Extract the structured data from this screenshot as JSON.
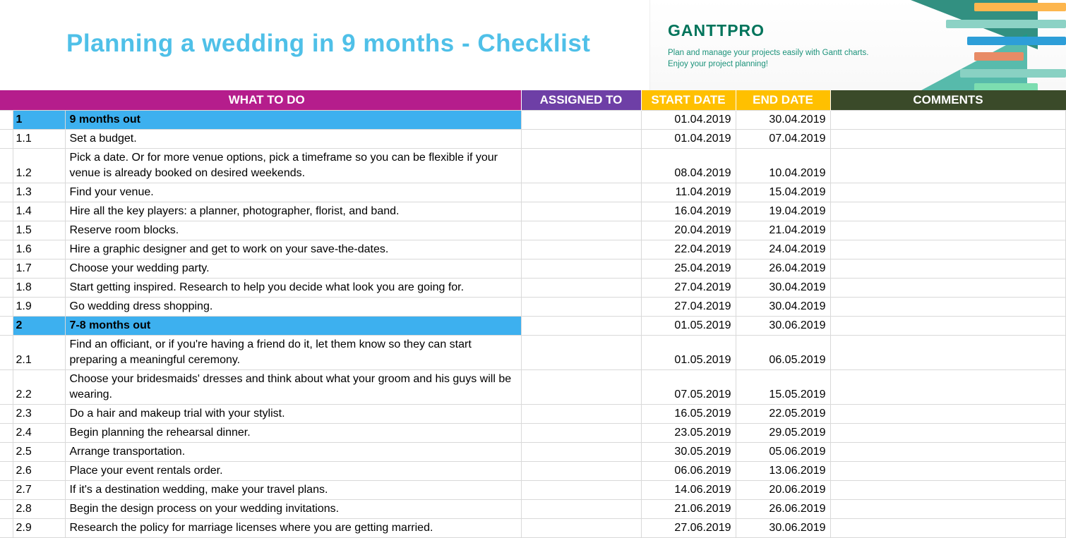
{
  "title": "Planning a wedding in 9 months - Checklist",
  "promo": {
    "logo": "GANTTPRO",
    "line1": "Plan and manage your projects easily with Gantt charts.",
    "line2": "Enjoy your project planning!"
  },
  "headers": {
    "what": "WHAT TO DO",
    "assigned": "ASSIGNED TO",
    "start": "START DATE",
    "end": "END DATE",
    "comments": "COMMENTS"
  },
  "rows": [
    {
      "idx": "1",
      "what": "9 months out",
      "start": "01.04.2019",
      "end": "30.04.2019",
      "section": true
    },
    {
      "idx": "1.1",
      "what": "Set a budget.",
      "start": "01.04.2019",
      "end": "07.04.2019"
    },
    {
      "idx": "1.2",
      "what": "Pick a date. Or for more venue options, pick a timeframe so you can be flexible if your venue is already booked on desired weekends.",
      "start": "08.04.2019",
      "end": "10.04.2019",
      "tall": true
    },
    {
      "idx": "1.3",
      "what": "Find your venue.",
      "start": "11.04.2019",
      "end": "15.04.2019"
    },
    {
      "idx": "1.4",
      "what": "Hire all the key players: a planner, photographer, florist, and band.",
      "start": "16.04.2019",
      "end": "19.04.2019"
    },
    {
      "idx": "1.5",
      "what": "Reserve room blocks.",
      "start": "20.04.2019",
      "end": "21.04.2019"
    },
    {
      "idx": "1.6",
      "what": "Hire a graphic designer and get to work on your save-the-dates.",
      "start": "22.04.2019",
      "end": "24.04.2019"
    },
    {
      "idx": "1.7",
      "what": "Choose your wedding party.",
      "start": "25.04.2019",
      "end": "26.04.2019"
    },
    {
      "idx": "1.8",
      "what": "Start getting inspired. Research to help you decide what look you are going for.",
      "start": "27.04.2019",
      "end": "30.04.2019"
    },
    {
      "idx": "1.9",
      "what": "Go wedding dress shopping.",
      "start": "27.04.2019",
      "end": "30.04.2019"
    },
    {
      "idx": "2",
      "what": "7-8 months out",
      "start": "01.05.2019",
      "end": "30.06.2019",
      "section": true
    },
    {
      "idx": "2.1",
      "what": "Find an officiant, or if you're having a friend do it, let them know so they can start preparing a meaningful ceremony.",
      "start": "01.05.2019",
      "end": "06.05.2019",
      "tall": true
    },
    {
      "idx": "2.2",
      "what": "Choose your bridesmaids' dresses and think about what your groom and his guys will be wearing.",
      "start": "07.05.2019",
      "end": "15.05.2019",
      "tall": true
    },
    {
      "idx": "2.3",
      "what": "Do a hair and makeup trial with your stylist.",
      "start": "16.05.2019",
      "end": "22.05.2019"
    },
    {
      "idx": "2.4",
      "what": "Begin planning the rehearsal dinner.",
      "start": "23.05.2019",
      "end": "29.05.2019"
    },
    {
      "idx": "2.5",
      "what": "Arrange transportation.",
      "start": "30.05.2019",
      "end": "05.06.2019"
    },
    {
      "idx": "2.6",
      "what": "Place your event rentals order.",
      "start": "06.06.2019",
      "end": "13.06.2019"
    },
    {
      "idx": "2.7",
      "what": "If it's a destination wedding, make your travel plans.",
      "start": "14.06.2019",
      "end": "20.06.2019"
    },
    {
      "idx": "2.8",
      "what": "Begin the design process on your wedding invitations.",
      "start": "21.06.2019",
      "end": "26.06.2019"
    },
    {
      "idx": "2.9",
      "what": "Research the policy for marriage licenses where you are getting married.",
      "start": "27.06.2019",
      "end": "30.06.2019"
    }
  ]
}
